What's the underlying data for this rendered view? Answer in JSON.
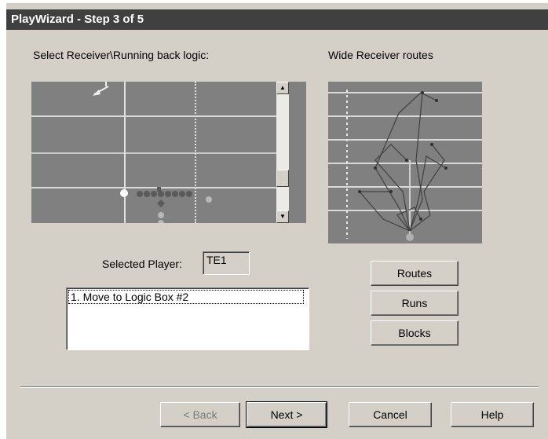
{
  "window": {
    "title": "PlayWizard - Step 3 of 5"
  },
  "left_panel": {
    "label": "Select Receiver\\Running back logic:",
    "selected_player_label": "Selected Player:",
    "selected_player_value": "TE1",
    "logic_items": [
      "1. Move to Logic Box #2"
    ]
  },
  "right_panel": {
    "label": "Wide Receiver routes",
    "buttons": {
      "routes": "Routes",
      "runs": "Runs",
      "blocks": "Blocks"
    }
  },
  "footer": {
    "back": "< Back",
    "next": "Next >",
    "cancel": "Cancel",
    "help": "Help"
  },
  "colors": {
    "field": "#808080",
    "yardline": "#d9d9d9",
    "player": "#5a5a5a",
    "route": "#404040"
  }
}
